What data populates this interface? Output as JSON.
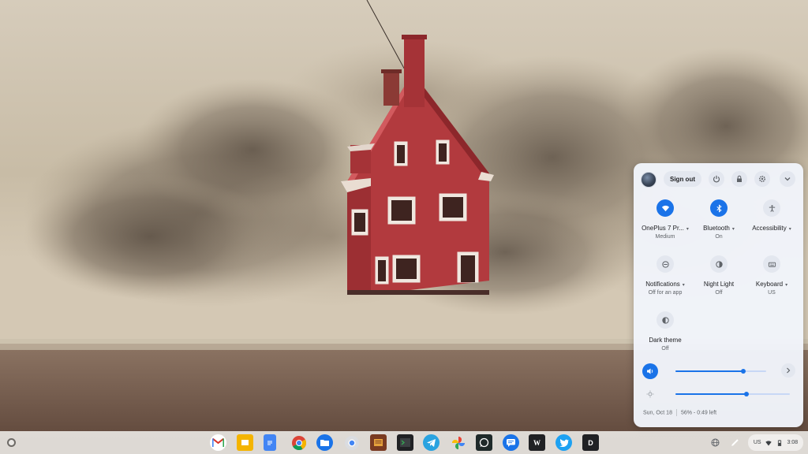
{
  "wallpaper": {
    "description_icon": "floating-red-house-wallpaper"
  },
  "quick_settings": {
    "sign_out_label": "Sign out",
    "top_icons": [
      "power-icon",
      "lock-icon",
      "gear-icon",
      "chevron-down-icon"
    ],
    "tiles": [
      {
        "label": "OnePlus 7 Pr...",
        "sub": "Medium",
        "icon": "wifi-icon",
        "active": true
      },
      {
        "label": "Bluetooth",
        "sub": "On",
        "icon": "bluetooth-icon",
        "active": true
      },
      {
        "label": "Accessibility",
        "sub": "",
        "icon": "accessibility-icon",
        "active": false
      },
      {
        "label": "Notifications",
        "sub": "Off for an app",
        "icon": "notifications-off-icon",
        "active": false
      },
      {
        "label": "Night Light",
        "sub": "Off",
        "icon": "night-light-icon",
        "active": false
      },
      {
        "label": "Keyboard",
        "sub": "US",
        "icon": "keyboard-icon",
        "active": false
      },
      {
        "label": "Dark theme",
        "sub": "Off",
        "icon": "dark-theme-icon",
        "active": false
      }
    ],
    "volume_level": 0.75,
    "brightness_level": 0.62,
    "footer": {
      "date": "Sun, Oct 18",
      "battery": "56% - 0:49 left"
    }
  },
  "shelf": {
    "apps": [
      "gmail",
      "google-slides",
      "google-docs",
      "chrome",
      "files",
      "chrome-alt",
      "books",
      "terminal",
      "telegram",
      "google-photos",
      "whatsapp",
      "messages",
      "wikipedia",
      "twitter",
      "d-app"
    ],
    "tray_left_icon": "globe-icon",
    "tray_pen_icon": "stylus-icon",
    "status": {
      "keyboard_layout": "US",
      "time": "3:08"
    }
  },
  "colors": {
    "accent": "#1a73e8",
    "house_red": "#b23a3e",
    "panel_bg": "#f1f4fa"
  }
}
